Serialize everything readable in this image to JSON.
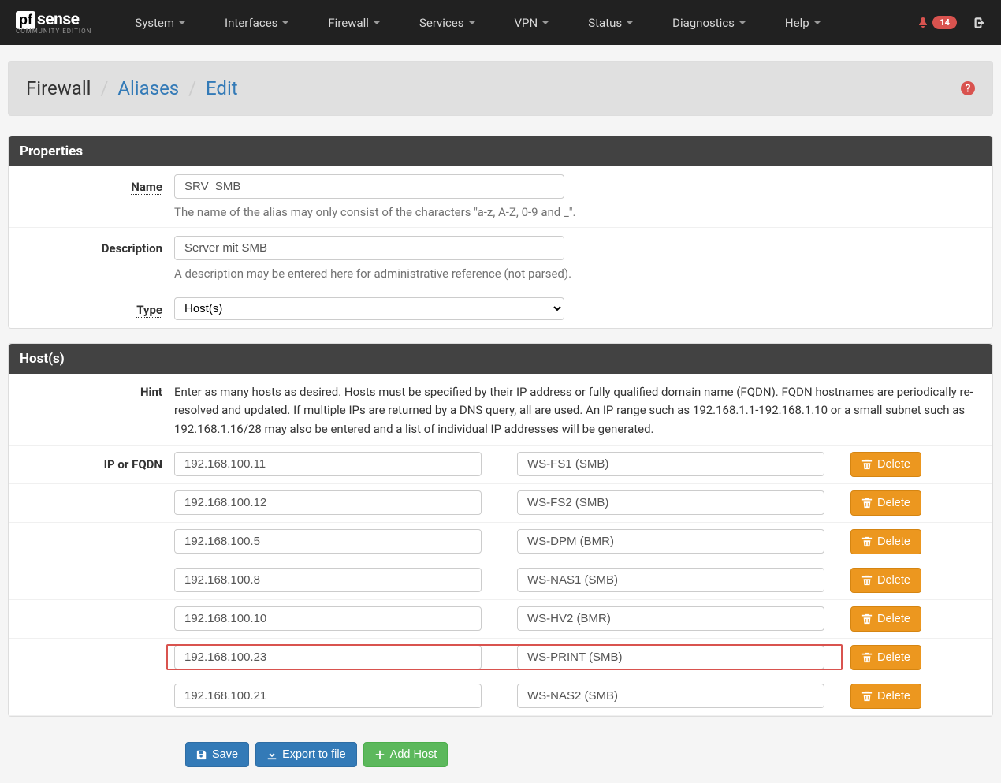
{
  "navbar": {
    "brand_pf": "pf",
    "brand_sense": "sense",
    "brand_sub": "COMMUNITY EDITION",
    "menu": [
      "System",
      "Interfaces",
      "Firewall",
      "Services",
      "VPN",
      "Status",
      "Diagnostics",
      "Help"
    ],
    "notification_count": "14"
  },
  "breadcrumb": {
    "root": "Firewall",
    "mid": "Aliases",
    "leaf": "Edit"
  },
  "panels": {
    "properties_title": "Properties",
    "hosts_title": "Host(s)"
  },
  "properties": {
    "name_label": "Name",
    "name_value": "SRV_SMB",
    "name_help": "The name of the alias may only consist of the characters \"a-z, A-Z, 0-9 and _\".",
    "description_label": "Description",
    "description_value": "Server mit SMB",
    "description_help": "A description may be entered here for administrative reference (not parsed).",
    "type_label": "Type",
    "type_value": "Host(s)"
  },
  "hosts_section": {
    "hint_label": "Hint",
    "hint_text": "Enter as many hosts as desired. Hosts must be specified by their IP address or fully qualified domain name (FQDN). FQDN hostnames are periodically re-resolved and updated. If multiple IPs are returned by a DNS query, all are used. An IP range such as 192.168.1.1-192.168.1.10 or a small subnet such as 192.168.1.16/28 may also be entered and a list of individual IP addresses will be generated.",
    "row_label": "IP or FQDN",
    "delete_label": "Delete",
    "hosts": [
      {
        "ip": "192.168.100.11",
        "desc": "WS-FS1 (SMB)",
        "highlight": false
      },
      {
        "ip": "192.168.100.12",
        "desc": "WS-FS2 (SMB)",
        "highlight": false
      },
      {
        "ip": "192.168.100.5",
        "desc": "WS-DPM (BMR)",
        "highlight": false
      },
      {
        "ip": "192.168.100.8",
        "desc": "WS-NAS1 (SMB)",
        "highlight": false
      },
      {
        "ip": "192.168.100.10",
        "desc": "WS-HV2 (BMR)",
        "highlight": false
      },
      {
        "ip": "192.168.100.23",
        "desc": "WS-PRINT (SMB)",
        "highlight": true
      },
      {
        "ip": "192.168.100.21",
        "desc": "WS-NAS2 (SMB)",
        "highlight": false
      }
    ]
  },
  "buttons": {
    "save": "Save",
    "export": "Export to file",
    "add_host": "Add Host"
  }
}
